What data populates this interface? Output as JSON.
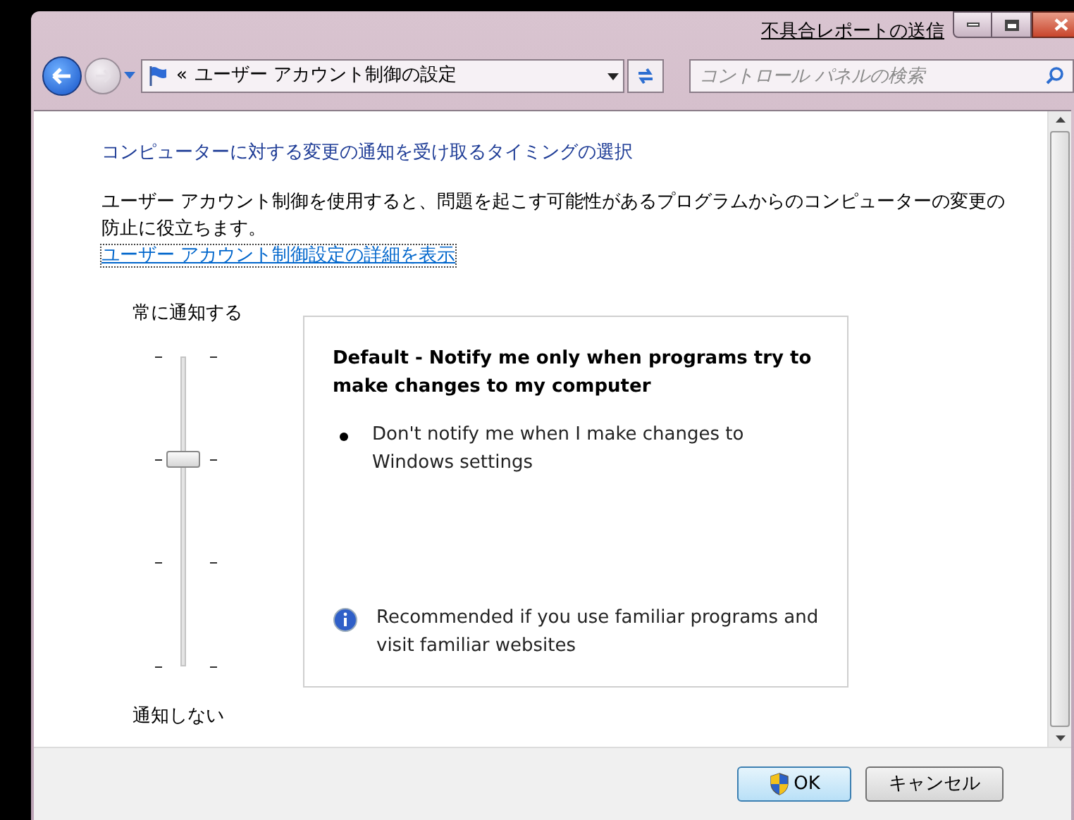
{
  "title_bar": {
    "link": "不具合レポートの送信"
  },
  "address_bar": {
    "chevron": "«",
    "path": "ユーザー アカウント制御の設定"
  },
  "search": {
    "placeholder": "コントロール パネルの検索"
  },
  "heading": "コンピューターに対する変更の通知を受け取るタイミングの選択",
  "description": "ユーザー アカウント制御を使用すると、問題を起こす可能性があるプログラムからのコンピューターの変更の防止に役立ちます。",
  "details_link": "ユーザー アカウント制御設定の詳細を表示",
  "slider": {
    "top_label": "常に通知する",
    "bottom_label": "通知しない",
    "level": 0.6667
  },
  "info_panel": {
    "title": "Default - Notify me only when programs try to make changes to my computer",
    "bullets": [
      "Don't notify me when I make changes to Windows settings"
    ],
    "note": "Recommended if you use familiar programs and visit familiar websites"
  },
  "buttons": [
    {
      "label": "OK",
      "kind": "shield"
    },
    {
      "label": "キャンセル",
      "kind": "plain"
    }
  ]
}
